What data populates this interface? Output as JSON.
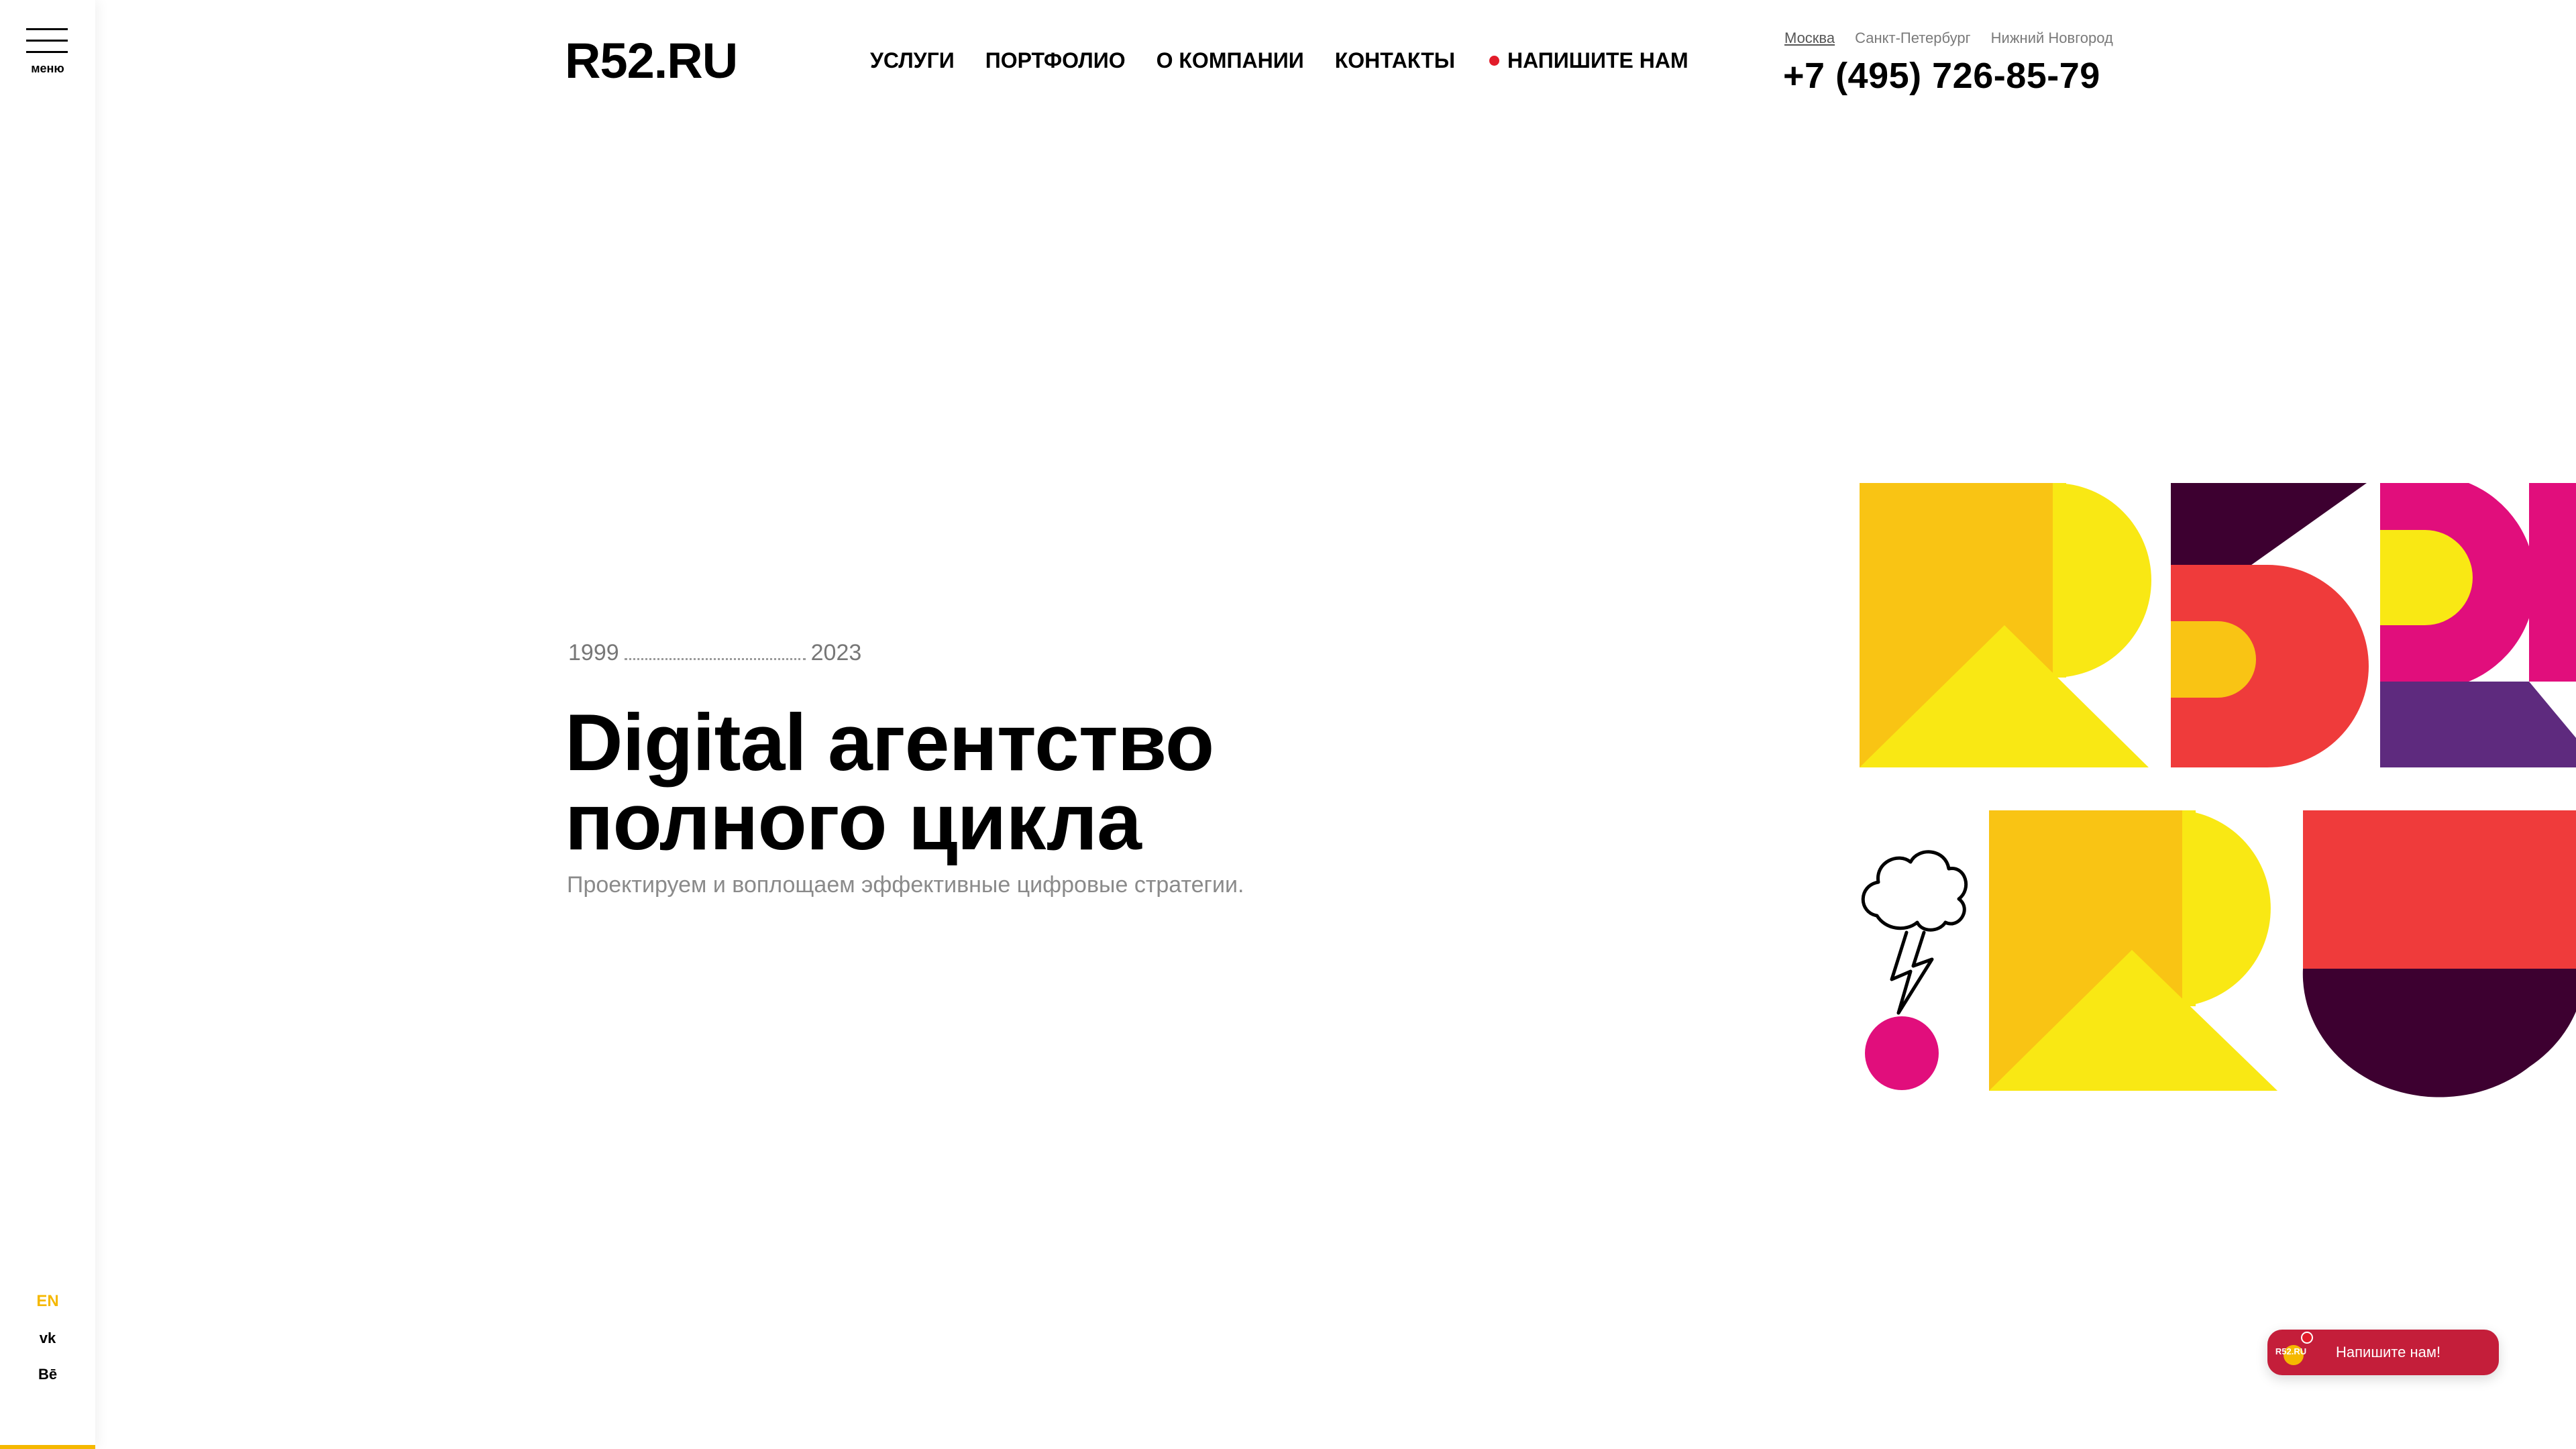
{
  "sidebar": {
    "menu_label": "меню",
    "lang": "EN",
    "vk": "vk",
    "behance": "Bē",
    "accent_color": "#f5b800"
  },
  "header": {
    "logo": "R52.RU",
    "nav": [
      "УСЛУГИ",
      "ПОРТФОЛИО",
      "О КОМПАНИИ",
      "КОНТАКТЫ"
    ],
    "write_us": "НАПИШИТЕ НАМ",
    "cities": [
      "Москва",
      "Санкт-Петербург",
      "Нижний Новгород"
    ],
    "active_city": "Москва",
    "phone": "+7 (495) 726-85-79"
  },
  "hero": {
    "year_start": "1999",
    "year_end": "2023",
    "title_line1": "Digital агентство",
    "title_line2": "полного цикла",
    "subtitle": "Проектируем и воплощаем эффективные цифровые стратегии."
  },
  "colors": {
    "yellow": "#f9c414",
    "bright_yellow": "#f9e814",
    "dark_plum": "#3d0030",
    "red": "#ef3b3b",
    "magenta": "#e10e7c",
    "purple": "#5e2a7e",
    "chat_red": "#c41e3a"
  },
  "chat": {
    "badge": "R52.RU",
    "label": "Напишите нам!"
  }
}
